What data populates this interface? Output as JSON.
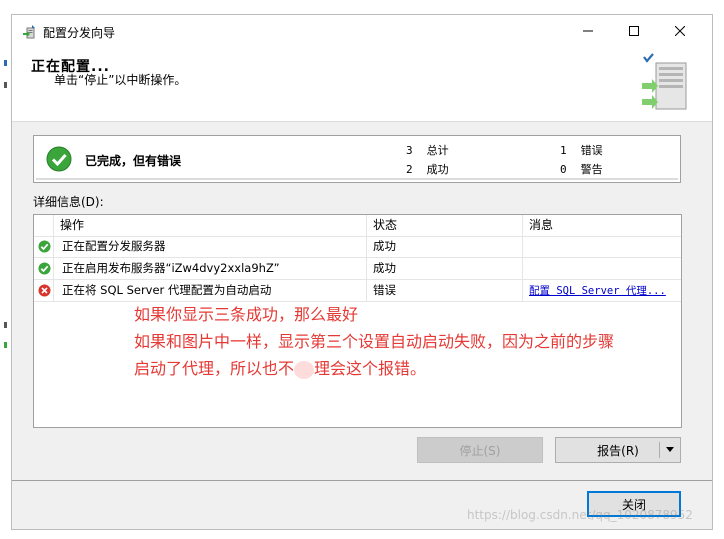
{
  "window": {
    "title": "配置分发向导",
    "controls": {
      "minimize": "minimize",
      "maximize": "maximize",
      "close": "close"
    }
  },
  "header": {
    "title": "正在配置...",
    "subtitle": "单击“停止”以中断操作。"
  },
  "status": {
    "text": "已完成，但有错误",
    "stats": {
      "total_count": "3",
      "total_label": "总计",
      "success_count": "2",
      "success_label": "成功",
      "error_count": "1",
      "error_label": "错误",
      "warning_count": "0",
      "warning_label": "警告"
    }
  },
  "details": {
    "label": "详细信息(D):",
    "columns": [
      "操作",
      "状态",
      "消息"
    ],
    "rows": [
      {
        "action": "正在配置分发服务器",
        "status": "成功",
        "message": "",
        "icon": "success-icon"
      },
      {
        "action": "正在启用发布服务器“iZw4dvy2xxla9hZ”",
        "status": "成功",
        "message": "",
        "icon": "success-icon"
      },
      {
        "action": "正在将 SQL Server 代理配置为自动启动",
        "status": "错误",
        "message": "配置 SQL Server 代理...",
        "icon": "error-icon"
      }
    ]
  },
  "annotation": {
    "line1": "如果你显示三条成功，那么最好",
    "line2": "如果和图片中一样，显示第三个设置自动启动失败，因为之前的步骤",
    "line3_a": "启动了代理，所以也不",
    "line3_b": "理会这个报错。"
  },
  "buttons": {
    "stop": "停止(S)",
    "report": "报告(R)",
    "close": "关闭"
  },
  "watermark": "https://blog.csdn.net/qq_1020878952",
  "colors": {
    "success": "#3aa53a",
    "error": "#d9342b",
    "annotation": "#e53935",
    "link": "#0000cc",
    "accent": "#0078d7"
  }
}
